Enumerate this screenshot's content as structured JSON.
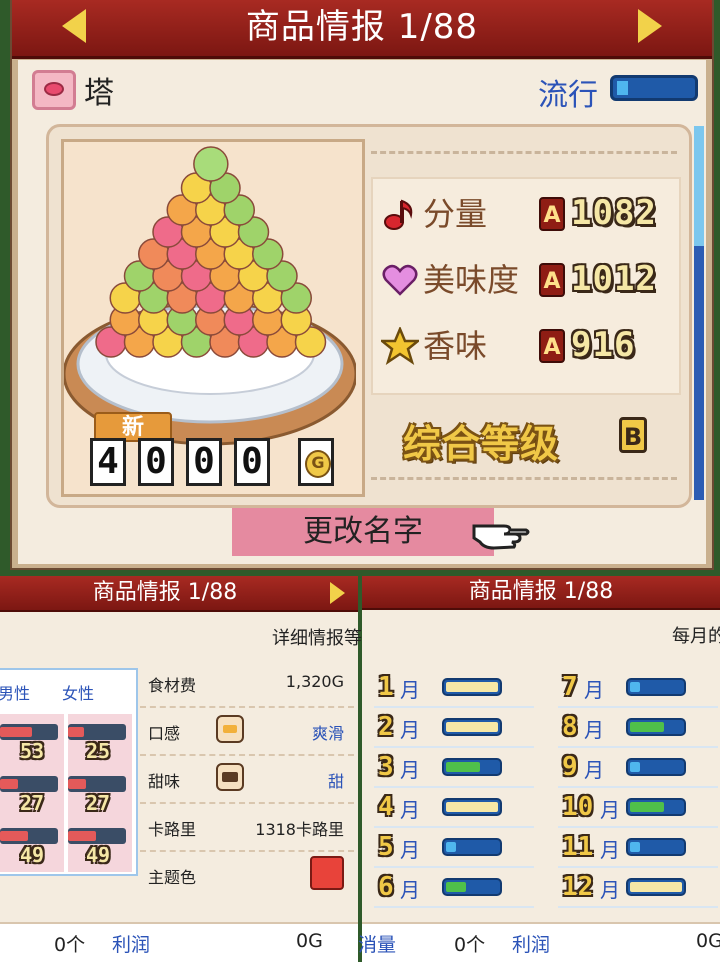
{
  "top": {
    "title": "商品情报 1/88",
    "category": {
      "icon": "lips-icon",
      "label": "塔"
    },
    "trend": {
      "label": "流行",
      "level_fraction": 0.15
    },
    "stats": [
      {
        "icon": "music-note-icon",
        "label": "分量",
        "grade": "A",
        "value": "1082"
      },
      {
        "icon": "heart-icon",
        "label": "美味度",
        "grade": "A",
        "value": "1012"
      },
      {
        "icon": "star-icon",
        "label": "香味",
        "grade": "A",
        "value": "916"
      }
    ],
    "overall": {
      "label": "综合等级",
      "grade": "B"
    },
    "new_badge": "新",
    "price_digits": [
      "4",
      "0",
      "0",
      "0"
    ],
    "price_currency": "G",
    "rename_button": "更改名字",
    "product_image": "macaron-tower-icon"
  },
  "bottom_left": {
    "title": "商品情报 1/88",
    "subtitle": "详细情报等",
    "gender_labels": {
      "male": "男性",
      "female": "女性"
    },
    "gender_values": [
      {
        "male": "53",
        "female": "25"
      },
      {
        "male": "27",
        "female": "27"
      },
      {
        "male": "49",
        "female": "49"
      }
    ],
    "details": [
      {
        "label": "食材费",
        "value": "1,320G"
      },
      {
        "label": "口感",
        "value": "爽滑",
        "icon": "texture-icon"
      },
      {
        "label": "甜味",
        "value": "甜",
        "icon": "sweetness-icon"
      },
      {
        "label": "卡路里",
        "value": "1318卡路里"
      },
      {
        "label": "主题色",
        "value": "",
        "color": "#e8433a"
      }
    ],
    "footer": {
      "count": "0个",
      "profit_label": "利润",
      "profit_value": "0G"
    }
  },
  "bottom_right": {
    "title": "商品情报 1/88",
    "subtitle": "每月的",
    "month_unit": "月",
    "months": [
      {
        "num": "1",
        "level": "full"
      },
      {
        "num": "2",
        "level": "full"
      },
      {
        "num": "3",
        "level": "green"
      },
      {
        "num": "4",
        "level": "full"
      },
      {
        "num": "5",
        "level": "low"
      },
      {
        "num": "6",
        "level": "green-low"
      },
      {
        "num": "7",
        "level": "low"
      },
      {
        "num": "8",
        "level": "green"
      },
      {
        "num": "9",
        "level": "low"
      },
      {
        "num": "10",
        "level": "green"
      },
      {
        "num": "11",
        "level": "low"
      },
      {
        "num": "12",
        "level": "full"
      }
    ],
    "footer": {
      "sales_label": "消量",
      "count": "0个",
      "profit_label": "利润",
      "profit_value": "0G"
    }
  },
  "colors": {
    "header_red": "#a82a22",
    "accent_blue": "#2b53b8",
    "gold": "#f0c847",
    "theme_color": "#e8433a"
  }
}
